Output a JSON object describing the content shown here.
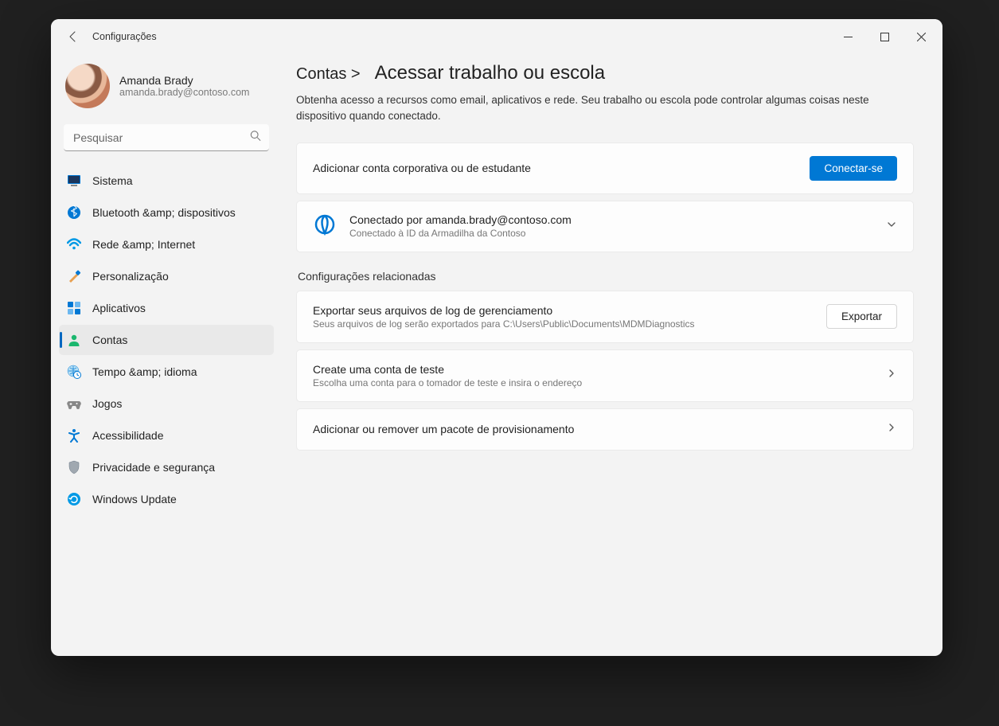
{
  "titlebar": {
    "title": "Configurações"
  },
  "profile": {
    "name": "Amanda Brady",
    "email": "amanda.brady@contoso.com"
  },
  "search": {
    "placeholder": "Pesquisar"
  },
  "sidebar": {
    "items": [
      {
        "label": "Sistema"
      },
      {
        "label": "Bluetooth &amp; dispositivos"
      },
      {
        "label": "Rede &amp; Internet"
      },
      {
        "label": "Personalização"
      },
      {
        "label": "Aplicativos"
      },
      {
        "label": "Contas"
      },
      {
        "label": "Tempo &amp; idioma"
      },
      {
        "label": "Jogos"
      },
      {
        "label": "Acessibilidade"
      },
      {
        "label": "Privacidade e segurança"
      },
      {
        "label": "Windows Update"
      }
    ]
  },
  "header": {
    "crumb_prev": "Contas >",
    "crumb_cur": "Acessar trabalho ou escola",
    "description": "Obtenha acesso a recursos como email, aplicativos e rede. Seu trabalho ou escola pode controlar algumas coisas neste dispositivo quando conectado."
  },
  "add_account": {
    "title": "Adicionar conta corporativa ou de estudante",
    "button": "Conectar-se"
  },
  "connected": {
    "title": "Conectado por amanda.brady@contoso.com",
    "sub": "Conectado à ID da Armadilha da Contoso"
  },
  "related": {
    "section_title": "Configurações relacionadas",
    "export": {
      "title": "Exportar seus arquivos de log de gerenciamento",
      "sub": "Seus arquivos de log serão exportados para C:\\Users\\Public\\Documents\\MDMDiagnostics",
      "button": "Exportar"
    },
    "test_account": {
      "title": "Create uma conta de teste",
      "sub": "Escolha uma conta para o tomador de teste e insira o endereço"
    },
    "provisioning": {
      "title": "Adicionar ou remover um pacote de provisionamento"
    }
  }
}
